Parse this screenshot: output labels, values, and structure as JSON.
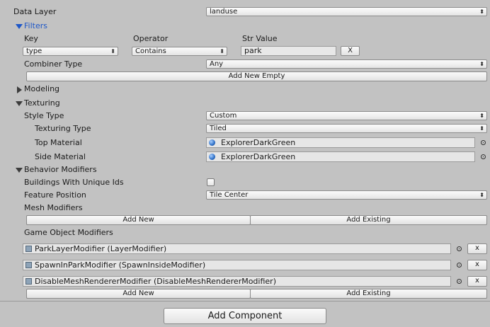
{
  "data_layer": {
    "label": "Data Layer",
    "value": "landuse"
  },
  "filters": {
    "title": "Filters",
    "col_key": "Key",
    "col_operator": "Operator",
    "col_value": "Str Value",
    "key_value": "type",
    "operator_value": "Contains",
    "str_value": "park",
    "remove_label": "X",
    "combiner_label": "Combiner Type",
    "combiner_value": "Any",
    "add_new_empty": "Add New Empty"
  },
  "modeling": {
    "title": "Modeling"
  },
  "texturing": {
    "title": "Texturing",
    "style_label": "Style Type",
    "style_value": "Custom",
    "type_label": "Texturing Type",
    "type_value": "Tiled",
    "top_label": "Top Material",
    "top_value": "ExplorerDarkGreen",
    "side_label": "Side Material",
    "side_value": "ExplorerDarkGreen"
  },
  "behavior": {
    "title": "Behavior Modifiers",
    "unique_ids_label": "Buildings With Unique Ids",
    "unique_ids_checked": false,
    "feature_pos_label": "Feature Position",
    "feature_pos_value": "Tile Center",
    "mesh_label": "Mesh Modifiers",
    "mesh_add_new": "Add New",
    "mesh_add_existing": "Add Existing",
    "go_label": "Game Object Modifiers",
    "go_items": [
      "ParkLayerModifier (LayerModifier)",
      "SpawnInParkModifier (SpawnInsideModifier)",
      "DisableMeshRendererModifier (DisableMeshRendererModifier)"
    ],
    "remove_label": "x",
    "go_add_new": "Add New",
    "go_add_existing": "Add Existing"
  },
  "add_component": "Add Component",
  "dropdown_arrow": "⬍"
}
